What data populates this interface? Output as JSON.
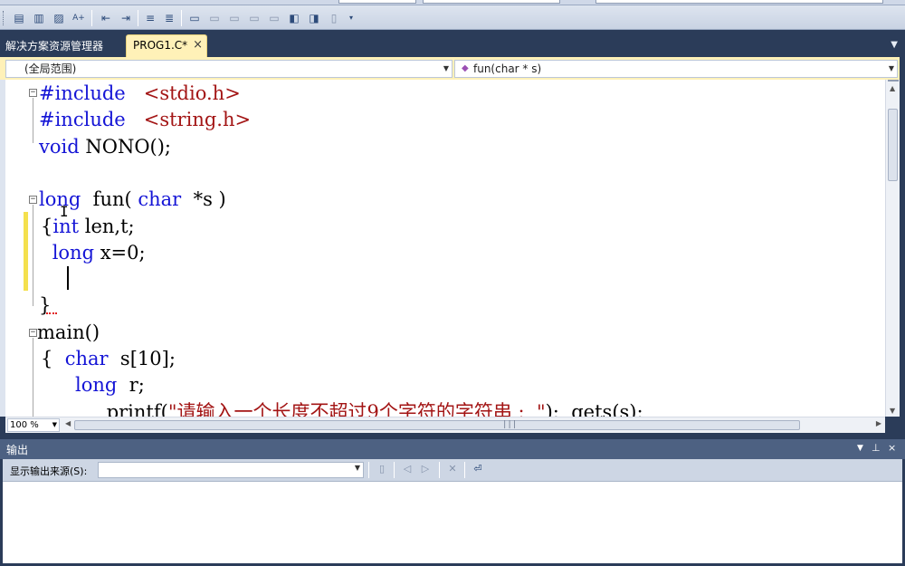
{
  "solution_explorer_tab": "解决方案资源管理器",
  "document_tab": {
    "label": "PROG1.C*",
    "close_glyph": "×"
  },
  "nav_bar": {
    "scope": "(全局范围)",
    "member": "fun(char * s)"
  },
  "code_lines": [
    {
      "parts": [
        {
          "t": "#include",
          "c": "pp"
        },
        {
          "t": "   ",
          "c": ""
        },
        {
          "t": "<stdio.h>",
          "c": "inc"
        }
      ]
    },
    {
      "parts": [
        {
          "t": "#include",
          "c": "pp"
        },
        {
          "t": "   ",
          "c": ""
        },
        {
          "t": "<string.h>",
          "c": "inc"
        }
      ]
    },
    {
      "parts": [
        {
          "t": "void",
          "c": "kw"
        },
        {
          "t": " NONO();",
          "c": ""
        }
      ]
    },
    {
      "parts": []
    },
    {
      "parts": [
        {
          "t": "long",
          "c": "kw"
        },
        {
          "t": "  fun( ",
          "c": ""
        },
        {
          "t": "char",
          "c": "kw"
        },
        {
          "t": "  *s )",
          "c": ""
        }
      ]
    },
    {
      "parts": [
        {
          "t": "{",
          "c": ""
        },
        {
          "t": "int",
          "c": "kw"
        },
        {
          "t": " len,t;",
          "c": ""
        }
      ]
    },
    {
      "parts": [
        {
          "t": " ",
          "c": ""
        },
        {
          "t": "long",
          "c": "kw"
        },
        {
          "t": " x=0;",
          "c": ""
        }
      ]
    },
    {
      "parts": []
    },
    {
      "parts": [
        {
          "t": "}",
          "c": ""
        }
      ]
    },
    {
      "parts": [
        {
          "t": "main()",
          "c": ""
        }
      ]
    },
    {
      "parts": [
        {
          "t": "{  ",
          "c": ""
        },
        {
          "t": "char",
          "c": "kw"
        },
        {
          "t": "  s[10];",
          "c": ""
        }
      ]
    },
    {
      "parts": [
        {
          "t": "   ",
          "c": ""
        },
        {
          "t": "long",
          "c": "kw"
        },
        {
          "t": "  r;",
          "c": ""
        }
      ]
    },
    {
      "parts": [
        {
          "t": "    printf(",
          "c": ""
        },
        {
          "t": "\"请输入一个长度不超过9个字符的字符串 :  \"",
          "c": "str"
        },
        {
          "t": ");  gets(s);",
          "c": ""
        }
      ]
    }
  ],
  "zoom": "100 %",
  "output_panel": {
    "title": "输出",
    "source_label": "显示输出来源(S):",
    "source_value": ""
  }
}
